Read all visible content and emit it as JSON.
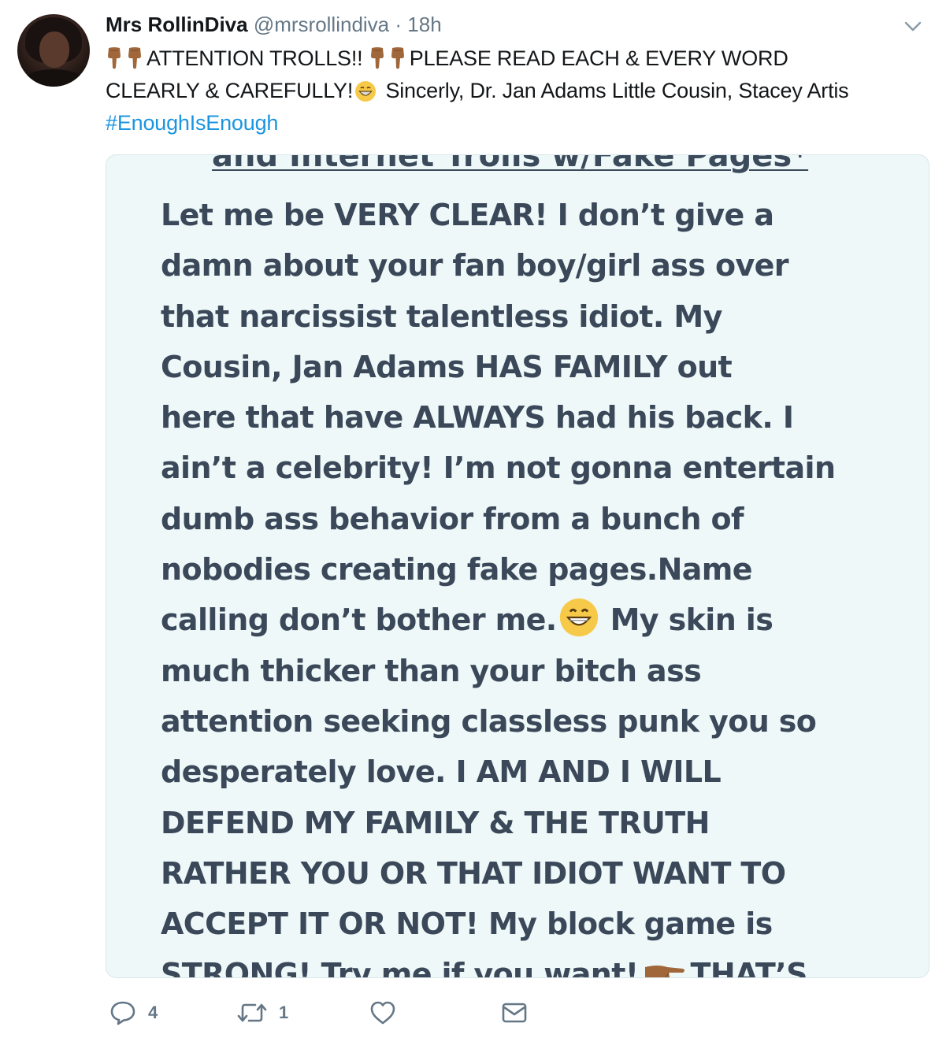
{
  "tweet": {
    "author": {
      "name": "Mrs RollinDiva",
      "handle": "@mrsrollindiva",
      "separator": "·",
      "time": "18h"
    },
    "text": {
      "line1_part1": "ATTENTION TROLLS!!",
      "line1_part2": "PLEASE READ EACH & EVERY WORD",
      "line2_part1": "CLEARLY & CAREFULLY!",
      "line2_part2": "Sincerly, Dr. Jan Adams Little Cousin, Stacey Artis",
      "hashtag": "#EnoughIsEnough"
    },
    "icons": {
      "down_pointing_emoji": "backhand-index-pointing-down-icon",
      "grin_emoji": "grinning-face-icon",
      "menu_chevron": "chevron-down-icon"
    },
    "media": {
      "top_cut_text": "and Internet Trolls w/Fake Pages*",
      "lines": [
        "Let me be VERY CLEAR! I don’t give a",
        "damn about your fan boy/girl ass over",
        "that narcissist talentless idiot. My",
        "Cousin, Jan Adams HAS FAMILY out",
        "here that have ALWAYS had his back. I",
        "ain’t a celebrity! I’m not gonna entertain",
        "dumb ass behavior from a bunch of",
        "nobodies creating fake pages.Name"
      ],
      "line9_part1": "calling don’t bother me.",
      "line9_part2": "My skin is",
      "lines_after": [
        "much thicker than your bitch ass",
        "attention seeking classless punk you so",
        "desperately love. I AM AND I WILL",
        "DEFEND MY FAMILY & THE TRUTH",
        "RATHER YOU OR THAT IDIOT WANT TO",
        "ACCEPT IT OR NOT! My block game is"
      ],
      "last_part1": "STRONG! Try me if you want!",
      "last_part2": "THAT’S"
    },
    "actions": {
      "reply_count": "4",
      "retweet_count": "1"
    },
    "colors": {
      "text": "#14171a",
      "muted": "#657786",
      "link": "#1b95e0",
      "media_background": "#eef8f8",
      "media_text": "#3a4859",
      "emoji_skin": "#a0673b"
    }
  }
}
